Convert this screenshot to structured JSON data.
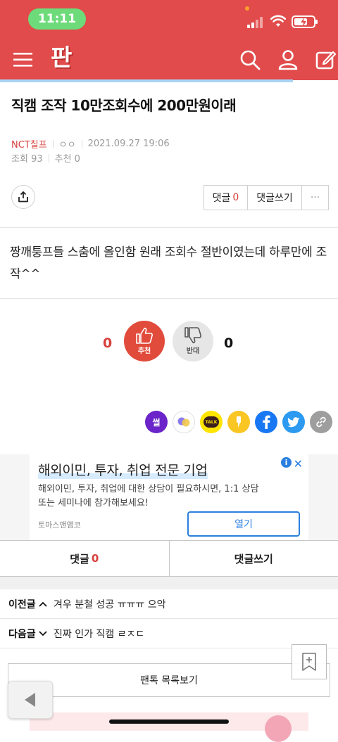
{
  "status": {
    "time": "11:11"
  },
  "header": {
    "logo": "판"
  },
  "post": {
    "title": "직캠 조작 10만조회수에 200만원이래",
    "author": "NCT칠프",
    "user": "ㅇㅇ",
    "date": "2021.09.27 19:06",
    "views_label": "조회",
    "views": "93",
    "recommend_label": "추천",
    "recommend": "0",
    "body": "짱깨퉁프들 스춤에 올인함 원래 조회수 절반이였는데 하루만에 조작^^"
  },
  "actions": {
    "comment_label": "댓글",
    "comment_count": "0",
    "write_comment": "댓글쓰기",
    "more": "···"
  },
  "vote": {
    "up_count": "0",
    "up_label": "추천",
    "down_count": "0",
    "down_label": "반대"
  },
  "share": {
    "icons": [
      "ssul-icon",
      "pair-icon",
      "kakaotalk-icon",
      "kakaostory-icon",
      "facebook-icon",
      "twitter-icon",
      "link-icon"
    ],
    "ssul_text": "썰",
    "talk_text": "TALK"
  },
  "ad": {
    "title": "해외이민, 투자, 취업 전문 기업",
    "desc": "해외이민, 투자, 취업에 대한 상담이 필요하시면, 1:1 상담 또는 세미나에 참가해보세요!",
    "company": "토마스앤앰코",
    "open": "열기",
    "info": "i",
    "close": "✕"
  },
  "bottom_tabs": {
    "comment_label": "댓글",
    "comment_count": "0",
    "write_comment": "댓글쓰기"
  },
  "nav": {
    "prev_label": "이전글",
    "prev_title": "겨우 분철 성공 ㅠㅠㅠ 으악",
    "next_label": "다음글",
    "next_title": "진짜 인가 직캠 ㄹㅈㄷ"
  },
  "list_button": "팬톡 목록보기",
  "colors": {
    "brand": "#e14b4b",
    "accent_red": "#d8403c",
    "blue": "#2a7fe0"
  }
}
